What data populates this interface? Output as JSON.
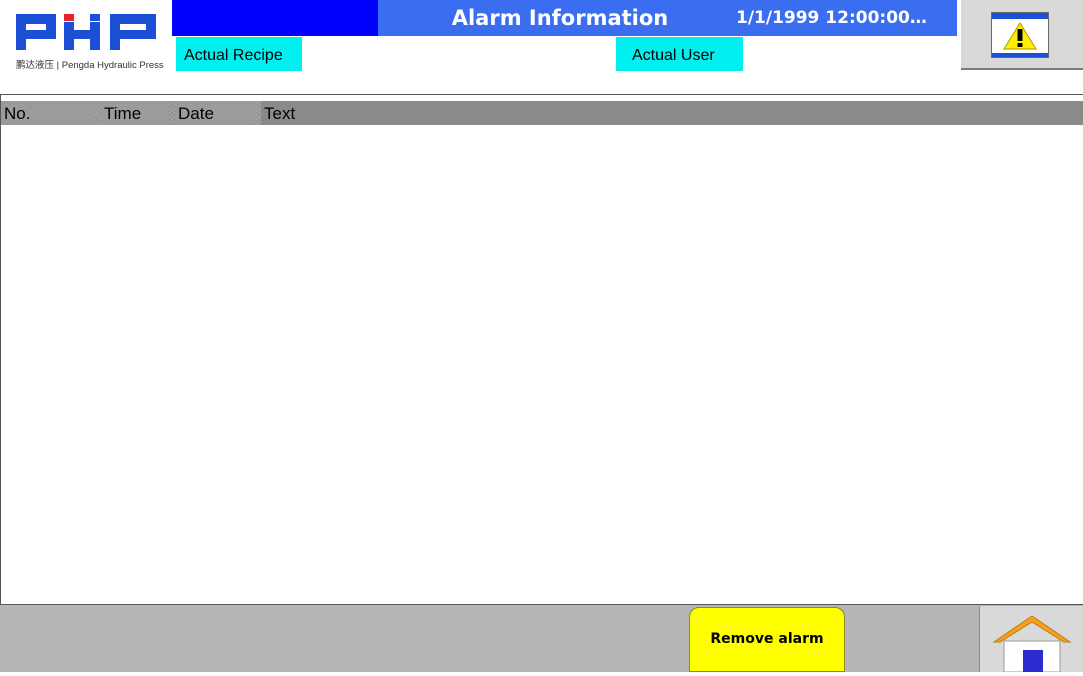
{
  "header": {
    "logo": {
      "mark": "PHP",
      "caption": "鹏达液压 | Pengda Hydraulic Press"
    },
    "title": "Alarm Information",
    "datetime": "1/1/1999 12:00:00…",
    "actual_recipe": "Actual Recipe",
    "actual_user": "Actual User",
    "alarm_button_icon": "alarm-window-icon"
  },
  "alarm_table": {
    "columns": [
      "No.",
      "Time",
      "Date",
      "Text"
    ],
    "rows": []
  },
  "footer": {
    "remove_alarm_label": "Remove alarm",
    "home_icon": "home-icon"
  },
  "colors": {
    "header_blue": "#0000ff",
    "header_light_blue": "#3a6df0",
    "tag_cyan": "#00f0f0",
    "button_yellow": "#ffff00",
    "logo_blue": "#1a4fd6",
    "logo_red": "#e8212b",
    "footer_gray": "#b6b6b6"
  }
}
